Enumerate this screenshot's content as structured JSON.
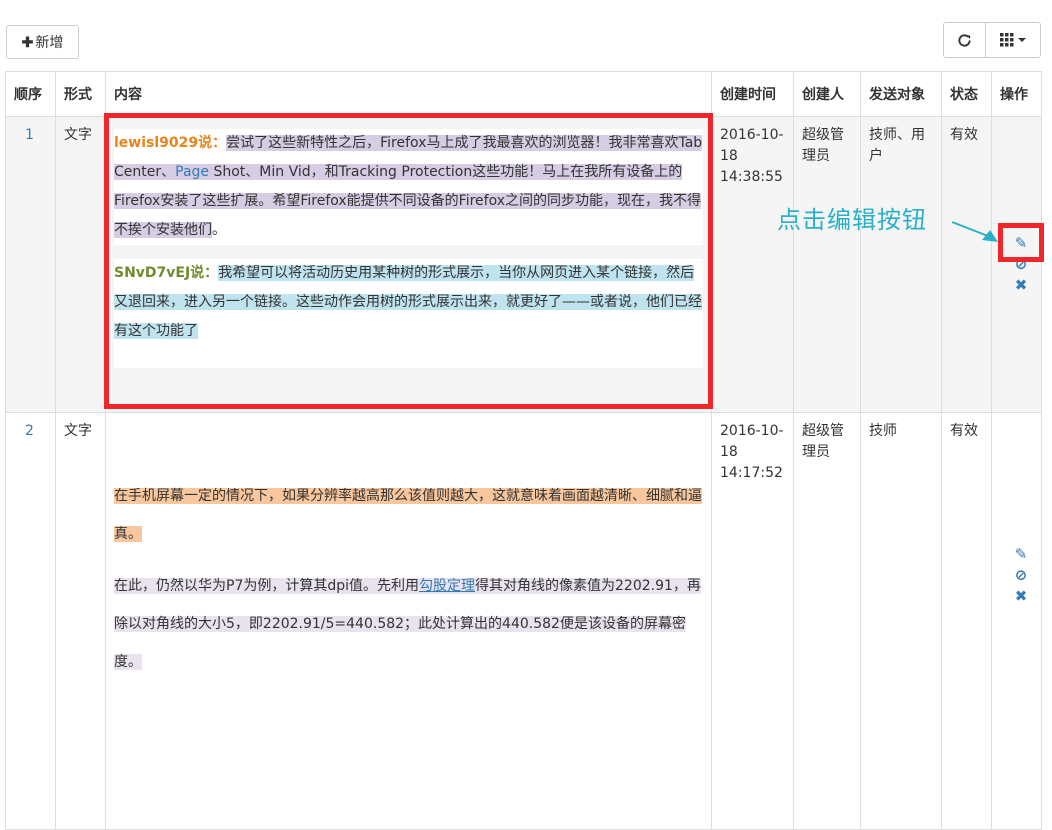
{
  "toolbar": {
    "add_label": "新增",
    "add_icon": "plus-icon",
    "refresh_icon": "refresh-icon",
    "columns_icon": "grid-icon"
  },
  "table": {
    "headers": [
      "顺序",
      "形式",
      "内容",
      "创建时间",
      "创建人",
      "发送对象",
      "状态",
      "操作"
    ],
    "rows": [
      {
        "index": "1",
        "form": "文字",
        "content": {
          "p1_name": "lewisl9029说：",
          "p1_text_a": "尝试了这些新特性之后，Firefox马上成了我最喜欢的浏览器！我非常喜欢Tab Center、",
          "p1_link": "Page",
          "p1_text_b": " Shot、Min Vid，和Tracking Protection这些功能！马上在我所有设备上的Firefox安装了这些扩展。希望Firefox能提供不同设备的Firefox之间的同步功能，现在，我不得不挨个安装他们",
          "p1_end": "。",
          "p2_name": "SNvD7vEJ说：",
          "p2_text": "我希望可以将活动历史用某种树的形式展示，当你从网页进入某个链接，然后又退回来，进入另一个链接。这些动作会用树的形式展示出来，就更好了——或者说，他们已经有这个功能了"
        },
        "created_time": "2016-10-18 14:38:55",
        "creator": "超级管理员",
        "target": "技师、用户",
        "status": "有效"
      },
      {
        "index": "2",
        "form": "文字",
        "content": {
          "p1": "在手机屏幕一定的情况下，如果分辨率越高那么该值则越大，这就意味着画面越清晰、细腻和逼真。",
          "p2_a": "在此，仍然以华为P7为例，计算其dpi值。先利用",
          "p2_link": "勾股定理",
          "p2_b": "得其对角线的像素值为2202.91，再除以对角线的大小5，即2202.91/5=440.582；此处计算出的440.582便是该设备的屏幕密度。"
        },
        "created_time": "2016-10-18 14:17:52",
        "creator": "超级管理员",
        "target": "技师",
        "status": "有效"
      }
    ],
    "ops": {
      "edit": "✎",
      "disable": "⊘",
      "delete": "✖"
    }
  },
  "annotation": {
    "text": "点击编辑按钮"
  },
  "colors": {
    "accent": "#337ab7",
    "highlight_red": "#f0262b",
    "annotation": "#2ab0c6"
  }
}
